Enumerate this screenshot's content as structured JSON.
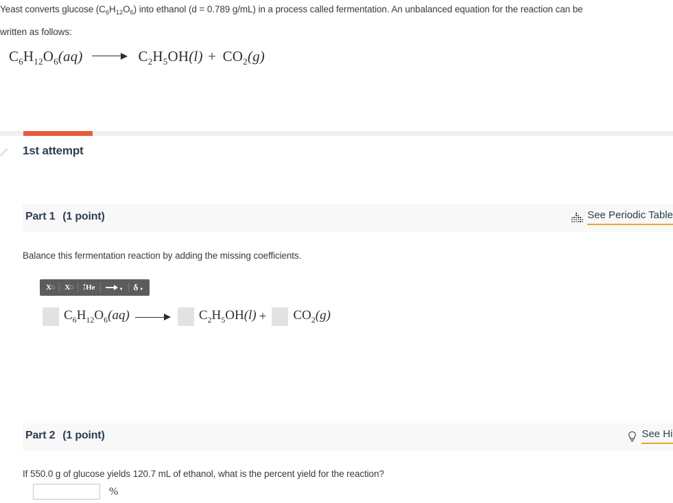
{
  "prompt": {
    "line1_a": "Yeast converts glucose (C",
    "line1_sub1": "6",
    "line1_b": "H",
    "line1_sub2": "12",
    "line1_c": "O",
    "line1_sub3": "6",
    "line1_d": ") into ethanol (d = 0.789 g/mL) in a process called fermentation. An unbalanced equation for the reaction can be",
    "line2": "written as follows:"
  },
  "equation_display": {
    "reactant": "C",
    "reactant_sub1": "6",
    "reactant_mid1": "H",
    "reactant_sub2": "12",
    "reactant_mid2": "O",
    "reactant_sub3": "6",
    "reactant_state": "(aq)",
    "product1": "C",
    "product1_sub1": "2",
    "product1_mid": "H",
    "product1_sub2": "5",
    "product1_end": "OH",
    "product1_state": "(l)",
    "plus": "+",
    "product2": "CO",
    "product2_sub": "2",
    "product2_state": "(g)"
  },
  "attempt": {
    "title": "1st attempt",
    "progress_percent": 10,
    "progress_color": "#e8593a",
    "icon": "pencil-icon"
  },
  "part1": {
    "label": "Part 1",
    "points": "(1 point)",
    "link_label": "See Periodic Table",
    "link_icon": "periodic-table-icon",
    "instruction": "Balance this fermentation reaction by adding the missing coefficients.",
    "toolbar": [
      {
        "name": "superscript-button",
        "label": "X",
        "mode": "superscript"
      },
      {
        "name": "subscript-button",
        "label": "X",
        "mode": "subscript"
      },
      {
        "name": "isotope-button",
        "label": "He",
        "mass_number": "4",
        "atomic_number": "2"
      },
      {
        "name": "arrow-button",
        "label": "→",
        "has_dropdown": true
      },
      {
        "name": "delta-button",
        "label": "δ",
        "has_dropdown": true
      }
    ],
    "coefficient_inputs": [
      "",
      "",
      ""
    ]
  },
  "part2": {
    "label": "Part 2",
    "points": "(1 point)",
    "link_label": "See Hint",
    "link_icon": "lightbulb-icon",
    "question": "If  550.0 g of glucose yields 120.7 mL of ethanol, what is the percent yield for the reaction?",
    "answer_value": "",
    "answer_placeholder": "",
    "unit": "%"
  },
  "colors": {
    "accent_orange": "#e8593a",
    "link_underline": "#e3a82b",
    "header_bg": "#f8f8f8",
    "input_box": "#e2e2e2",
    "heading_text": "#2d3e50"
  }
}
